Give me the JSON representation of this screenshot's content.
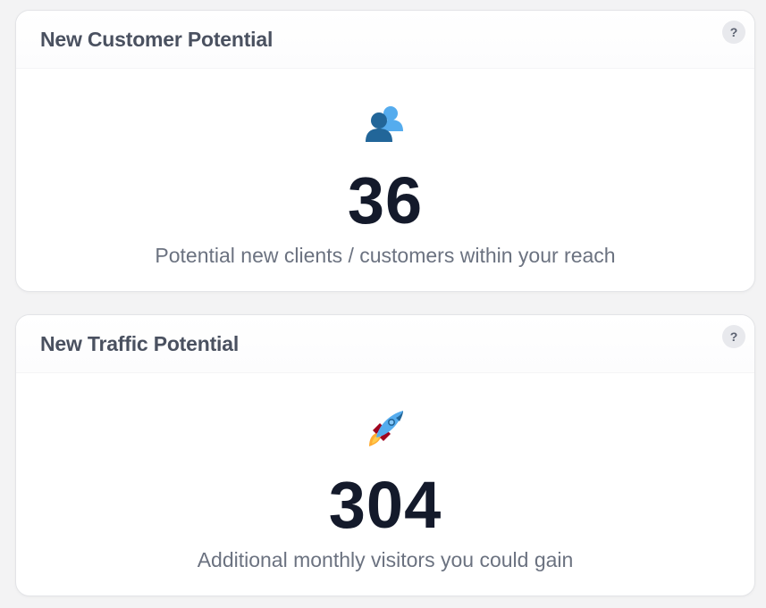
{
  "cards": [
    {
      "title": "New Customer Potential",
      "help_label": "?",
      "icon": "busts-in-silhouette-icon",
      "value": "36",
      "caption": "Potential new clients / customers within your reach"
    },
    {
      "title": "New Traffic Potential",
      "help_label": "?",
      "icon": "rocket-icon",
      "value": "304",
      "caption": "Additional monthly visitors you could gain"
    }
  ],
  "colors": {
    "background": "#f3f3f4",
    "card": "#ffffff",
    "title": "#4a5160",
    "number": "#141a2b",
    "caption": "#6b7280",
    "help_bg": "#e8e9ed"
  }
}
